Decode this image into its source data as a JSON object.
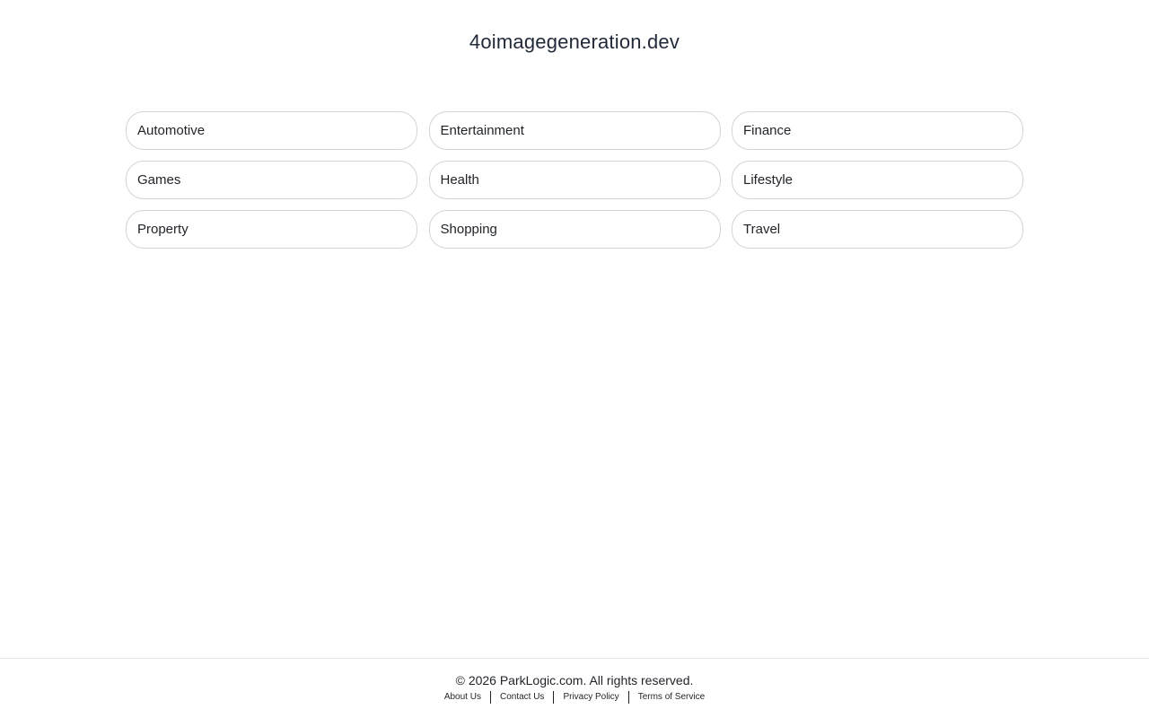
{
  "site": {
    "title": "4oimagegeneration.dev"
  },
  "categories": [
    {
      "label": "Automotive"
    },
    {
      "label": "Entertainment"
    },
    {
      "label": "Finance"
    },
    {
      "label": "Games"
    },
    {
      "label": "Health"
    },
    {
      "label": "Lifestyle"
    },
    {
      "label": "Property"
    },
    {
      "label": "Shopping"
    },
    {
      "label": "Travel"
    }
  ],
  "footer": {
    "copyright": "© 2026 ParkLogic.com. All rights reserved.",
    "links": [
      {
        "label": "About Us"
      },
      {
        "label": "Contact Us"
      },
      {
        "label": "Privacy Policy"
      },
      {
        "label": "Terms of Service"
      }
    ]
  },
  "colors": {
    "text": "#1f2328",
    "pill_border": "#d4d4d8",
    "footer_border": "#e5e7eb",
    "background": "#ffffff"
  }
}
